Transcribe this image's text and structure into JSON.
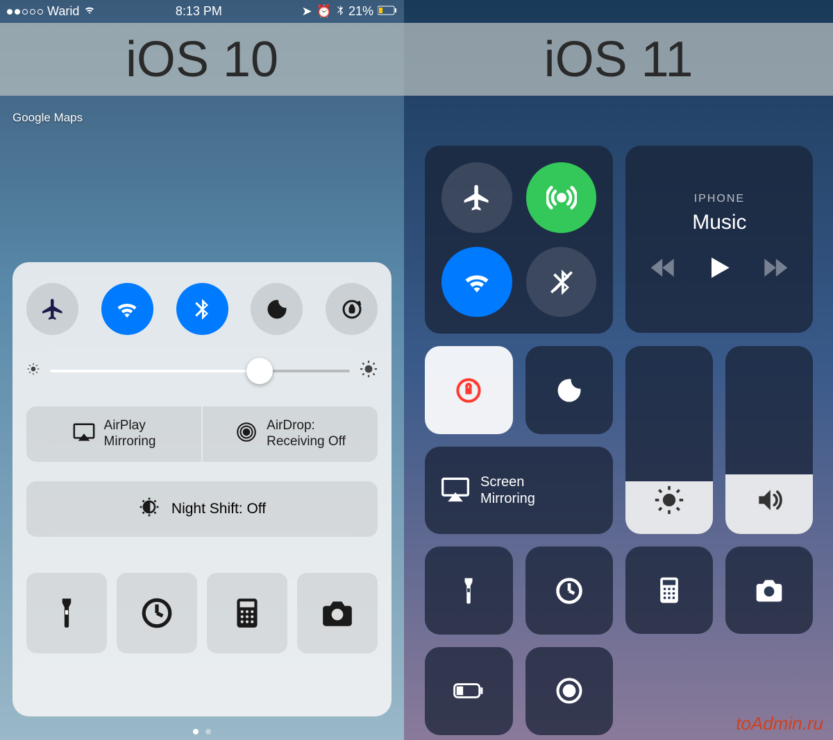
{
  "titles": {
    "left": "iOS 10",
    "right": "iOS 11"
  },
  "status": {
    "carrier": "Warid",
    "time": "8:13 PM",
    "battery": "21%"
  },
  "homescreen": {
    "app_label": "Google Maps"
  },
  "ios10": {
    "toggles": {
      "airplane": false,
      "wifi": true,
      "bluetooth": true,
      "dnd": false,
      "rotation_lock": false
    },
    "brightness_pct": 70,
    "airplay_label": "AirPlay\nMirroring",
    "airdrop_label": "AirDrop:\nReceiving Off",
    "nightshift_label": "Night Shift: Off",
    "quick": [
      "flashlight",
      "timer",
      "calculator",
      "camera"
    ]
  },
  "ios11": {
    "connectivity": {
      "airplane": false,
      "cellular": true,
      "wifi": true,
      "bluetooth": false
    },
    "media": {
      "subtitle": "IPHONE",
      "title": "Music"
    },
    "rotation_lock": true,
    "dnd": false,
    "screen_mirroring_label": "Screen\nMirroring",
    "brightness_pct": 28,
    "volume_pct": 32,
    "row_quick": [
      "flashlight",
      "timer",
      "calculator",
      "camera"
    ],
    "row_extra": [
      "low-power",
      "screen-record"
    ]
  },
  "watermark": "toAdmin.ru"
}
